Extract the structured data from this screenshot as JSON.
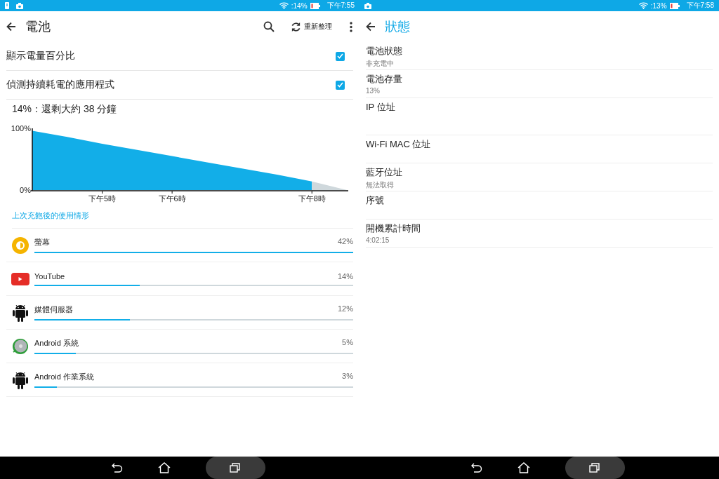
{
  "screens": [
    {
      "kind": "battery",
      "status_bar": {
        "time": "下午7:55",
        "battery": ":14%",
        "notifications": [
          {
            "kind": "alert"
          },
          {
            "kind": "media"
          }
        ]
      },
      "toolbar": {
        "title": "電池",
        "action": "重新整理"
      },
      "settings": [
        {
          "label": "顯示電量百分比",
          "checked": true
        },
        {
          "label": "偵測持續耗電的應用程式",
          "checked": true
        }
      ],
      "summary": "14%：還剩大約 38 分鐘",
      "chart_data": {
        "type": "area",
        "categories": [
          null,
          null,
          "下午5時",
          null,
          "下午6時",
          null,
          null,
          null,
          "下午8時",
          null
        ],
        "ylim": [
          0,
          100
        ],
        "yticks": [
          {
            "value": 0,
            "label": "0%"
          },
          {
            "value": 100,
            "label": "100%"
          }
        ],
        "series": [
          {
            "color": "#12aee8",
            "values": [
              96,
              86,
              75,
              65,
              55,
              45,
              35,
              25,
              14,
              null
            ]
          },
          {
            "color": "#cfd8dc",
            "values": [
              null,
              null,
              null,
              null,
              null,
              null,
              null,
              null,
              14,
              0
            ]
          }
        ]
      },
      "usage_heading": "上次充飽後的使用情形",
      "usage": [
        {
          "kind": "screen",
          "name": "螢幕",
          "percent": "42%",
          "level": 1.0
        },
        {
          "kind": "youtube",
          "name": "YouTube",
          "percent": "14%",
          "level": 0.33
        },
        {
          "kind": "android",
          "name": "媒體伺服器",
          "percent": "12%",
          "level": 0.3
        },
        {
          "kind": "disc",
          "name": "Android 系統",
          "percent": "5%",
          "level": 0.13
        },
        {
          "kind": "android",
          "name": "Android 作業系統",
          "percent": "3%",
          "level": 0.07
        }
      ]
    },
    {
      "kind": "status",
      "status_bar": {
        "time": "下午7:58",
        "battery": ":13%",
        "notifications": [
          {
            "kind": "media"
          }
        ]
      },
      "toolbar": {
        "title": "狀態"
      },
      "items": [
        {
          "title": "電池狀態",
          "summary": "非充電中"
        },
        {
          "title": "電池存量",
          "summary": "13%"
        },
        {
          "title": "IP 位址"
        },
        {
          "title": "Wi-Fi MAC 位址"
        },
        {
          "title": "藍牙位址",
          "summary": "無法取得"
        },
        {
          "title": "序號"
        },
        {
          "title": "開機累計時間",
          "summary": "4:02:15"
        }
      ]
    }
  ]
}
